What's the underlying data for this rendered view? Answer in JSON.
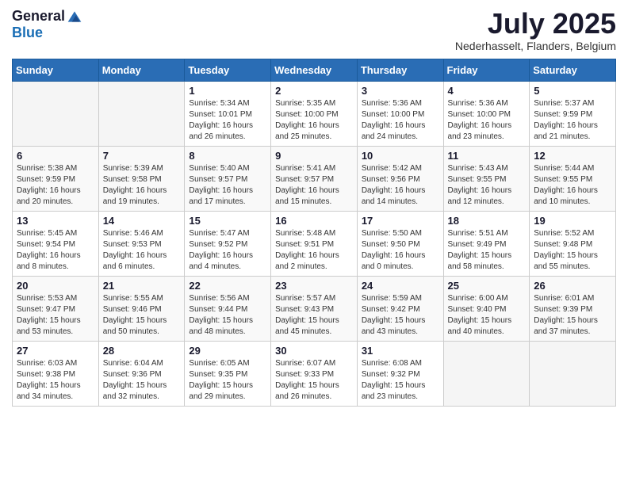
{
  "logo": {
    "general": "General",
    "blue": "Blue"
  },
  "title": "July 2025",
  "location": "Nederhasselt, Flanders, Belgium",
  "days_of_week": [
    "Sunday",
    "Monday",
    "Tuesday",
    "Wednesday",
    "Thursday",
    "Friday",
    "Saturday"
  ],
  "weeks": [
    [
      {
        "day": "",
        "info": ""
      },
      {
        "day": "",
        "info": ""
      },
      {
        "day": "1",
        "info": "Sunrise: 5:34 AM\nSunset: 10:01 PM\nDaylight: 16 hours\nand 26 minutes."
      },
      {
        "day": "2",
        "info": "Sunrise: 5:35 AM\nSunset: 10:00 PM\nDaylight: 16 hours\nand 25 minutes."
      },
      {
        "day": "3",
        "info": "Sunrise: 5:36 AM\nSunset: 10:00 PM\nDaylight: 16 hours\nand 24 minutes."
      },
      {
        "day": "4",
        "info": "Sunrise: 5:36 AM\nSunset: 10:00 PM\nDaylight: 16 hours\nand 23 minutes."
      },
      {
        "day": "5",
        "info": "Sunrise: 5:37 AM\nSunset: 9:59 PM\nDaylight: 16 hours\nand 21 minutes."
      }
    ],
    [
      {
        "day": "6",
        "info": "Sunrise: 5:38 AM\nSunset: 9:59 PM\nDaylight: 16 hours\nand 20 minutes."
      },
      {
        "day": "7",
        "info": "Sunrise: 5:39 AM\nSunset: 9:58 PM\nDaylight: 16 hours\nand 19 minutes."
      },
      {
        "day": "8",
        "info": "Sunrise: 5:40 AM\nSunset: 9:57 PM\nDaylight: 16 hours\nand 17 minutes."
      },
      {
        "day": "9",
        "info": "Sunrise: 5:41 AM\nSunset: 9:57 PM\nDaylight: 16 hours\nand 15 minutes."
      },
      {
        "day": "10",
        "info": "Sunrise: 5:42 AM\nSunset: 9:56 PM\nDaylight: 16 hours\nand 14 minutes."
      },
      {
        "day": "11",
        "info": "Sunrise: 5:43 AM\nSunset: 9:55 PM\nDaylight: 16 hours\nand 12 minutes."
      },
      {
        "day": "12",
        "info": "Sunrise: 5:44 AM\nSunset: 9:55 PM\nDaylight: 16 hours\nand 10 minutes."
      }
    ],
    [
      {
        "day": "13",
        "info": "Sunrise: 5:45 AM\nSunset: 9:54 PM\nDaylight: 16 hours\nand 8 minutes."
      },
      {
        "day": "14",
        "info": "Sunrise: 5:46 AM\nSunset: 9:53 PM\nDaylight: 16 hours\nand 6 minutes."
      },
      {
        "day": "15",
        "info": "Sunrise: 5:47 AM\nSunset: 9:52 PM\nDaylight: 16 hours\nand 4 minutes."
      },
      {
        "day": "16",
        "info": "Sunrise: 5:48 AM\nSunset: 9:51 PM\nDaylight: 16 hours\nand 2 minutes."
      },
      {
        "day": "17",
        "info": "Sunrise: 5:50 AM\nSunset: 9:50 PM\nDaylight: 16 hours\nand 0 minutes."
      },
      {
        "day": "18",
        "info": "Sunrise: 5:51 AM\nSunset: 9:49 PM\nDaylight: 15 hours\nand 58 minutes."
      },
      {
        "day": "19",
        "info": "Sunrise: 5:52 AM\nSunset: 9:48 PM\nDaylight: 15 hours\nand 55 minutes."
      }
    ],
    [
      {
        "day": "20",
        "info": "Sunrise: 5:53 AM\nSunset: 9:47 PM\nDaylight: 15 hours\nand 53 minutes."
      },
      {
        "day": "21",
        "info": "Sunrise: 5:55 AM\nSunset: 9:46 PM\nDaylight: 15 hours\nand 50 minutes."
      },
      {
        "day": "22",
        "info": "Sunrise: 5:56 AM\nSunset: 9:44 PM\nDaylight: 15 hours\nand 48 minutes."
      },
      {
        "day": "23",
        "info": "Sunrise: 5:57 AM\nSunset: 9:43 PM\nDaylight: 15 hours\nand 45 minutes."
      },
      {
        "day": "24",
        "info": "Sunrise: 5:59 AM\nSunset: 9:42 PM\nDaylight: 15 hours\nand 43 minutes."
      },
      {
        "day": "25",
        "info": "Sunrise: 6:00 AM\nSunset: 9:40 PM\nDaylight: 15 hours\nand 40 minutes."
      },
      {
        "day": "26",
        "info": "Sunrise: 6:01 AM\nSunset: 9:39 PM\nDaylight: 15 hours\nand 37 minutes."
      }
    ],
    [
      {
        "day": "27",
        "info": "Sunrise: 6:03 AM\nSunset: 9:38 PM\nDaylight: 15 hours\nand 34 minutes."
      },
      {
        "day": "28",
        "info": "Sunrise: 6:04 AM\nSunset: 9:36 PM\nDaylight: 15 hours\nand 32 minutes."
      },
      {
        "day": "29",
        "info": "Sunrise: 6:05 AM\nSunset: 9:35 PM\nDaylight: 15 hours\nand 29 minutes."
      },
      {
        "day": "30",
        "info": "Sunrise: 6:07 AM\nSunset: 9:33 PM\nDaylight: 15 hours\nand 26 minutes."
      },
      {
        "day": "31",
        "info": "Sunrise: 6:08 AM\nSunset: 9:32 PM\nDaylight: 15 hours\nand 23 minutes."
      },
      {
        "day": "",
        "info": ""
      },
      {
        "day": "",
        "info": ""
      }
    ]
  ]
}
